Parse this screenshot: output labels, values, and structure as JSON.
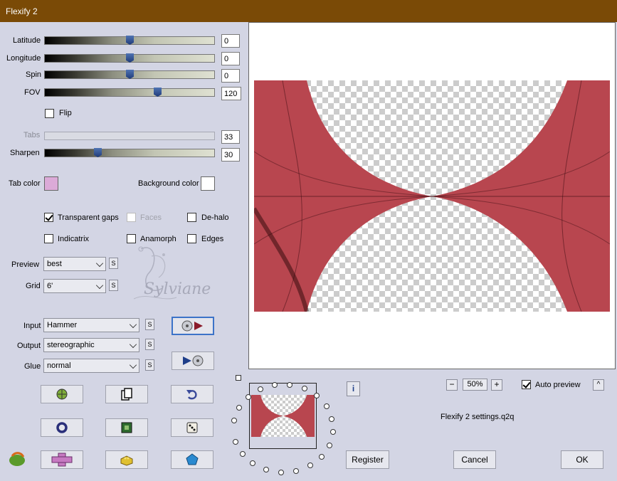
{
  "window": {
    "title": "Flexify 2"
  },
  "sliders": [
    {
      "key": "latitude",
      "label": "Latitude",
      "value": "0",
      "level": 0.5
    },
    {
      "key": "longitude",
      "label": "Longitude",
      "value": "0",
      "level": 0.5
    },
    {
      "key": "spin",
      "label": "Spin",
      "value": "0",
      "level": 0.5
    },
    {
      "key": "fov",
      "label": "FOV",
      "value": "120",
      "level": 0.67
    },
    {
      "key": "tabs",
      "label": "Tabs",
      "value": "33",
      "level": null
    },
    {
      "key": "sharpen",
      "label": "Sharpen",
      "value": "30",
      "level": 0.3
    }
  ],
  "flip": {
    "label": "Flip",
    "checked": false
  },
  "colors": {
    "tab_label": "Tab color",
    "tab_value": "#dcaad8",
    "background_label": "Background color",
    "background_value": "#ffffff"
  },
  "options": {
    "transparent_gaps": {
      "label": "Transparent gaps",
      "checked": true
    },
    "faces": {
      "label": "Faces",
      "checked": false,
      "disabled": true
    },
    "de_halo": {
      "label": "De-halo",
      "checked": false
    },
    "indicatrix": {
      "label": "Indicatrix",
      "checked": false
    },
    "anamorph": {
      "label": "Anamorph",
      "checked": false
    },
    "edges": {
      "label": "Edges",
      "checked": false
    }
  },
  "preview_quality": {
    "label": "Preview",
    "value": "best"
  },
  "grid": {
    "label": "Grid",
    "value": "6'"
  },
  "input": {
    "label": "Input",
    "value": "Hammer"
  },
  "output": {
    "label": "Output",
    "value": "stereographic"
  },
  "glue": {
    "label": "Glue",
    "value": "normal"
  },
  "s_button": "S",
  "zoom": {
    "value": "50%",
    "minus": "−",
    "plus": "+"
  },
  "auto_preview": {
    "label": "Auto preview",
    "checked": true
  },
  "collapse_button": "^",
  "settings_file": "Flexify 2 settings.q2q",
  "buttons": {
    "register": "Register",
    "cancel": "Cancel",
    "ok": "OK"
  },
  "info_icon": "i",
  "watermark": "Sylviane",
  "accent_colors": {
    "title_bar": "#7a4a06",
    "panel": "#d3d5e4",
    "preview_red": "#b84a52"
  }
}
